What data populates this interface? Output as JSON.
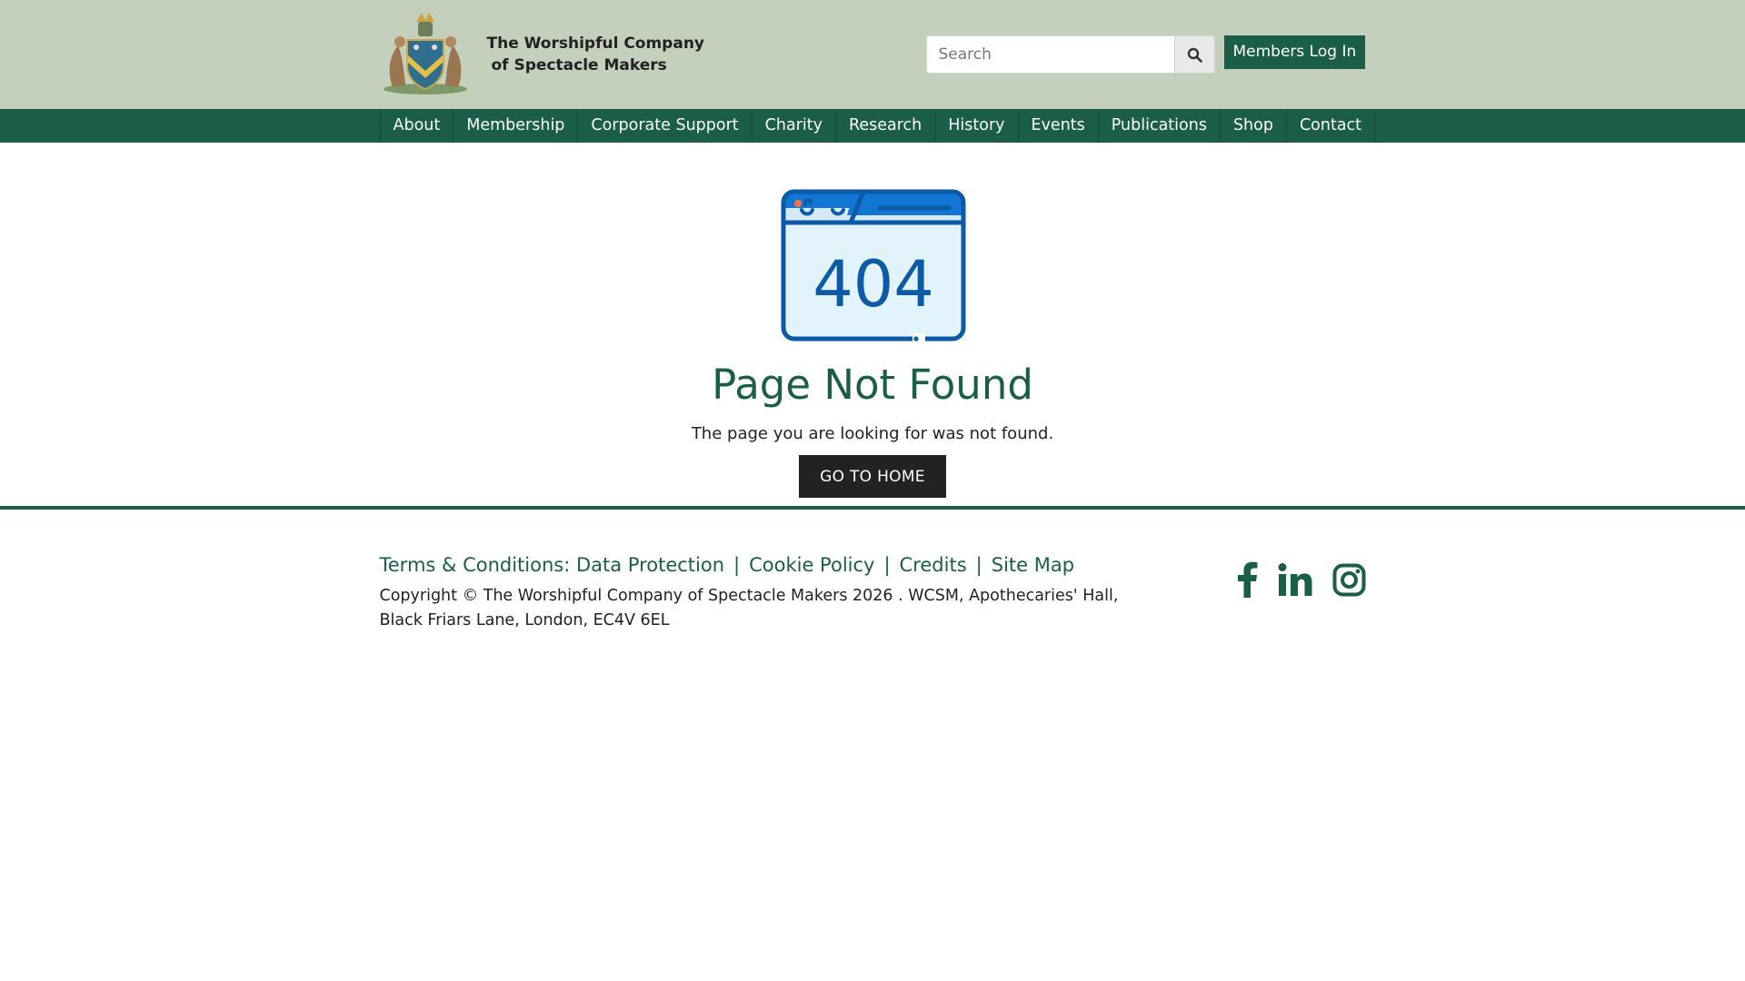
{
  "header": {
    "brand_line1": "The Worshipful Company",
    "brand_line2": "of Spectacle Makers",
    "search_placeholder": "Search",
    "search_value": "",
    "members_login": "Members Log In",
    "background": "#c4cfbc",
    "accent": "#1a5e47"
  },
  "nav": {
    "items": [
      {
        "label": "About"
      },
      {
        "label": "Membership"
      },
      {
        "label": "Corporate Support"
      },
      {
        "label": "Charity"
      },
      {
        "label": "Research"
      },
      {
        "label": "History"
      },
      {
        "label": "Events"
      },
      {
        "label": "Publications"
      },
      {
        "label": "Shop"
      },
      {
        "label": "Contact"
      }
    ]
  },
  "main": {
    "icon": "browser-404-icon",
    "icon_text": "404",
    "title": "Page Not Found",
    "message": "The page you are looking for was not found.",
    "home_button": "GO TO HOME"
  },
  "footer": {
    "links": [
      {
        "label": "Terms & Conditions: Data Protection"
      },
      {
        "label": "Cookie Policy"
      },
      {
        "label": "Credits"
      },
      {
        "label": "Site Map"
      }
    ],
    "copyright": "Copyright © The Worshipful Company of Spectacle Makers 2026 . WCSM, Apothecaries' Hall, Black Friars Lane, London, EC4V 6EL",
    "social": [
      "facebook-icon",
      "linkedin-icon",
      "instagram-icon"
    ]
  }
}
